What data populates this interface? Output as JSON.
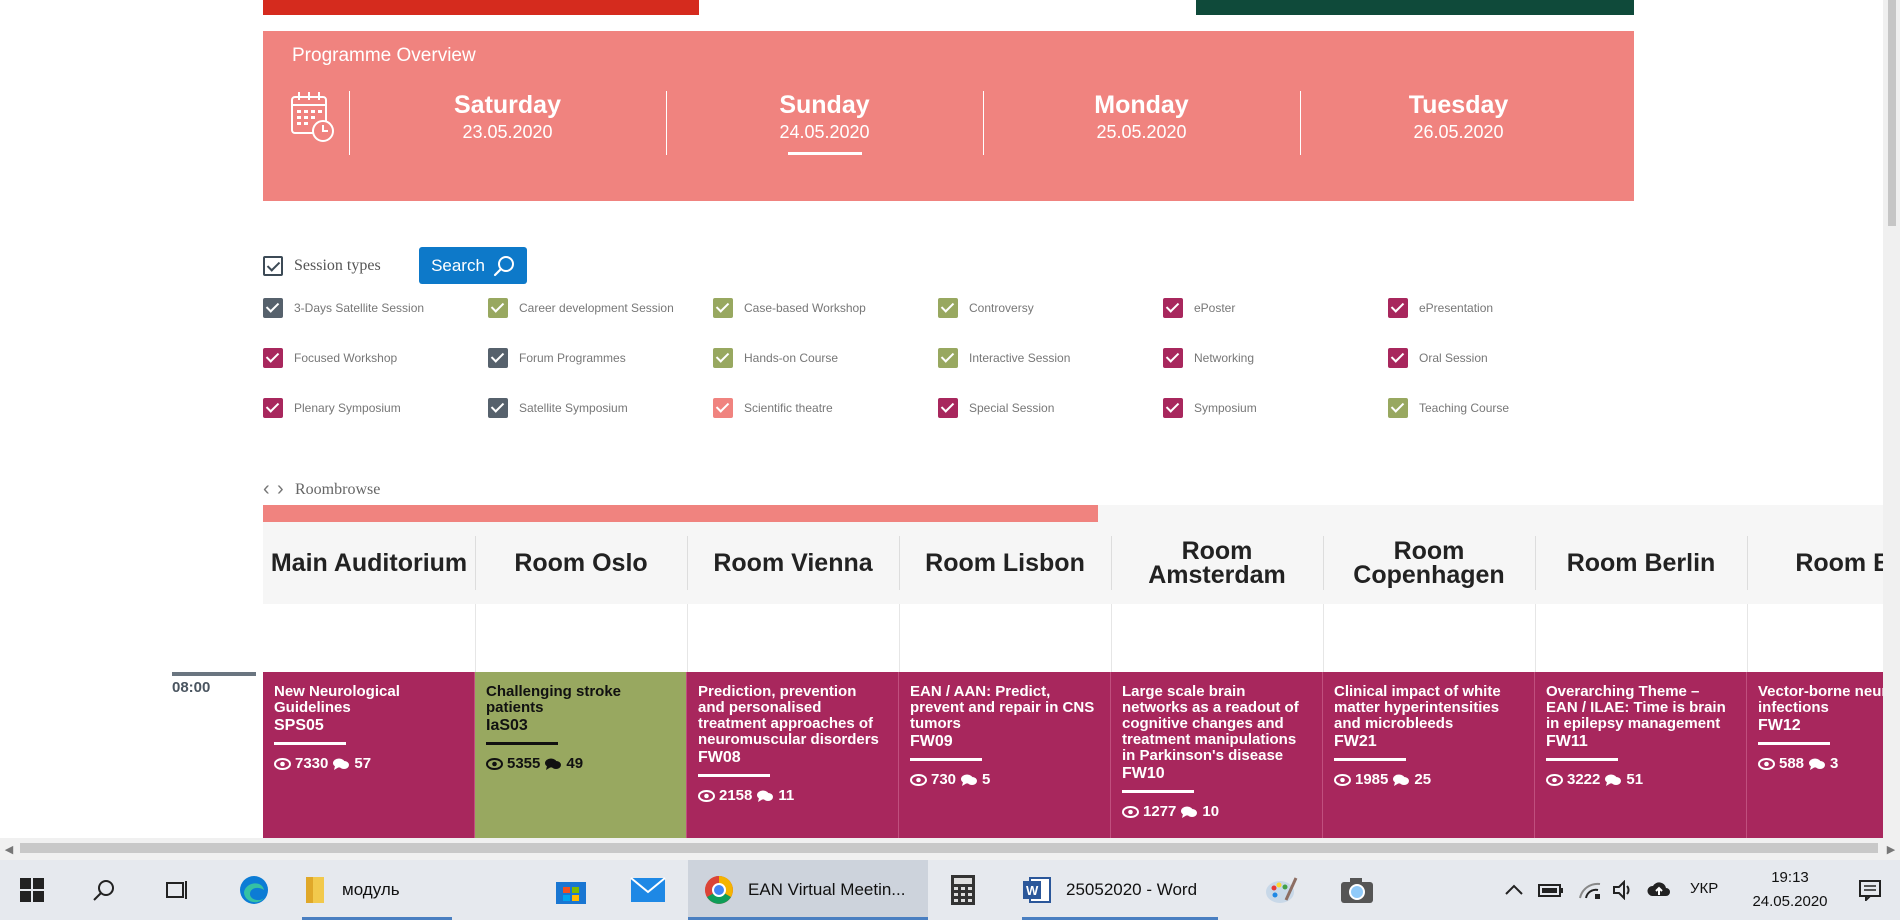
{
  "overview": {
    "title": "Programme Overview",
    "days": [
      {
        "name": "Saturday",
        "date": "23.05.2020",
        "selected": false
      },
      {
        "name": "Sunday",
        "date": "24.05.2020",
        "selected": true
      },
      {
        "name": "Monday",
        "date": "25.05.2020",
        "selected": false
      },
      {
        "name": "Tuesday",
        "date": "26.05.2020",
        "selected": false
      }
    ]
  },
  "filters": {
    "session_types_label": "Session types",
    "search_label": "Search",
    "types": [
      {
        "label": "3-Days Satellite Session",
        "color": "#56616c"
      },
      {
        "label": "Career development Session",
        "color": "#98a860"
      },
      {
        "label": "Case-based Workshop",
        "color": "#98a860"
      },
      {
        "label": "Controversy",
        "color": "#98a860"
      },
      {
        "label": "ePoster",
        "color": "#a8275d"
      },
      {
        "label": "ePresentation",
        "color": "#a8275d"
      },
      {
        "label": "Focused Workshop",
        "color": "#a8275d"
      },
      {
        "label": "Forum Programmes",
        "color": "#56616c"
      },
      {
        "label": "Hands-on Course",
        "color": "#98a860"
      },
      {
        "label": "Interactive Session",
        "color": "#98a860"
      },
      {
        "label": "Networking",
        "color": "#a8275d"
      },
      {
        "label": "Oral Session",
        "color": "#a8275d"
      },
      {
        "label": "Plenary Symposium",
        "color": "#a8275d"
      },
      {
        "label": "Satellite Symposium",
        "color": "#56616c"
      },
      {
        "label": "Scientific theatre",
        "color": "#f0837f"
      },
      {
        "label": "Special Session",
        "color": "#a8275d"
      },
      {
        "label": "Symposium",
        "color": "#a8275d"
      },
      {
        "label": "Teaching Course",
        "color": "#98a860"
      }
    ]
  },
  "roombrowse": {
    "label": "Roombrowse",
    "progress_fraction": 0.51,
    "rooms": [
      "Main Auditorium",
      "Room Oslo",
      "Room Vienna",
      "Room Lisbon",
      "Room Amsterdam",
      "Room Copenhagen",
      "Room Berlin",
      "Room Budapest"
    ]
  },
  "timeline": {
    "time": "08:00"
  },
  "sessions": [
    {
      "title": "New Neurological Guidelines",
      "code": "SPS05",
      "views": "7330",
      "comments": "57",
      "color": "magenta"
    },
    {
      "title": "Challenging stroke patients",
      "code": "IaS03",
      "views": "5355",
      "comments": "49",
      "color": "green"
    },
    {
      "title": "Prediction, prevention and personalised treatment approaches of neuromuscular disorders",
      "code": "FW08",
      "views": "2158",
      "comments": "11",
      "color": "magenta"
    },
    {
      "title": "EAN / AAN: Predict, prevent and repair in CNS tumors",
      "code": "FW09",
      "views": "730",
      "comments": "5",
      "color": "magenta"
    },
    {
      "title": "Large scale brain networks as a readout of cognitive changes and treatment manipulations in Parkinson's disease",
      "code": "FW10",
      "views": "1277",
      "comments": "10",
      "color": "magenta"
    },
    {
      "title": "Clinical impact of white matter hyperintensities and microbleeds",
      "code": "FW21",
      "views": "1985",
      "comments": "25",
      "color": "magenta"
    },
    {
      "title": "Overarching Theme – EAN / ILAE: Time is brain in epilepsy management",
      "code": "FW11",
      "views": "3222",
      "comments": "51",
      "color": "magenta"
    },
    {
      "title": "Vector-borne neuro infections",
      "code": "FW12",
      "views": "588",
      "comments": "3",
      "color": "magenta"
    }
  ],
  "taskbar": {
    "explorer_label": "модуль",
    "chrome_label": "EAN Virtual Meetin...",
    "word_label": "25052020 - Word",
    "language": "УКР",
    "time": "19:13",
    "date": "24.05.2020"
  }
}
